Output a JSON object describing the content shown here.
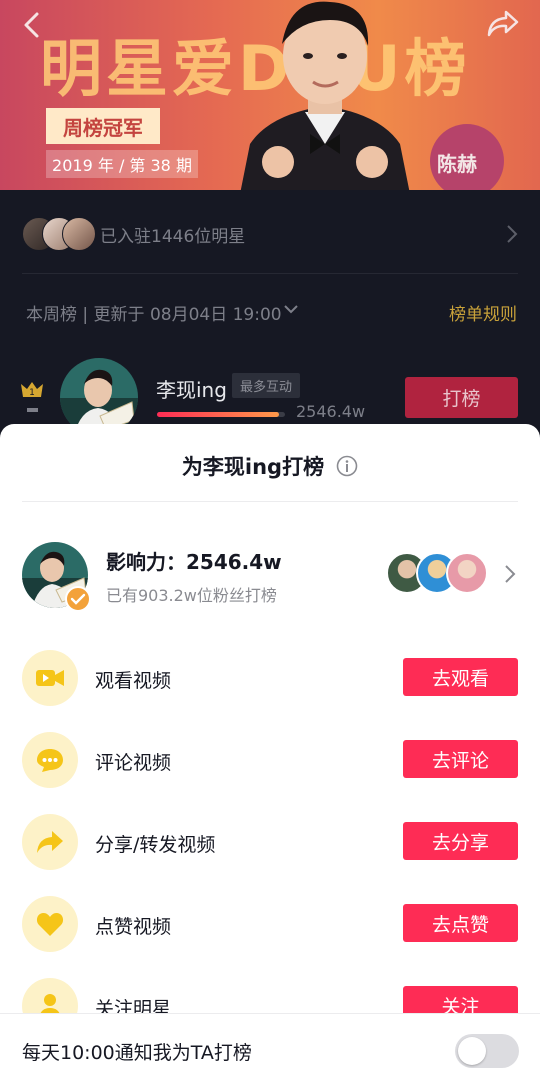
{
  "banner": {
    "title": "明星爱DOU榜",
    "champion_label": "周榜冠军",
    "period": "2019 年 / 第 38 期",
    "star_name": "陈赫"
  },
  "settled": {
    "text": "已入驻1446位明星"
  },
  "ranking_header": {
    "update_text": "本周榜 | 更新于 08月04日 19:00",
    "rules_label": "榜单规则"
  },
  "top_rank": {
    "name": "李现ing",
    "tag": "最多互动",
    "score": "2546.4w",
    "button_label": "打榜"
  },
  "sheet": {
    "title": "为李现ing打榜",
    "influence_title": "影响力：2546.4w",
    "influence_sub": "已有903.2w位粉丝打榜",
    "tasks": [
      {
        "label": "观看视频",
        "button": "去观看",
        "icon": "video-camera-icon"
      },
      {
        "label": "评论视频",
        "button": "去评论",
        "icon": "comment-bubble-icon"
      },
      {
        "label": "分享/转发视频",
        "button": "去分享",
        "icon": "share-arrow-icon"
      },
      {
        "label": "点赞视频",
        "button": "去点赞",
        "icon": "heart-icon"
      },
      {
        "label": "关注明星",
        "button": "关注",
        "icon": "person-icon"
      }
    ]
  },
  "notify": {
    "text": "每天10:00通知我为TA打榜",
    "enabled": false
  },
  "colors": {
    "accent_red": "#fe2c55",
    "gold": "#c9a23a",
    "task_icon_bg": "#fdf2c8",
    "task_icon_fg": "#f5c518"
  }
}
